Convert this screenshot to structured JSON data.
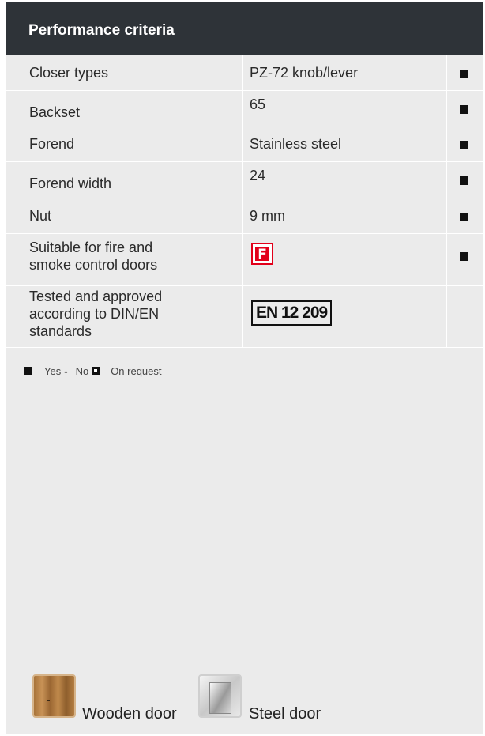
{
  "header": {
    "title": "Performance criteria"
  },
  "rows": [
    {
      "label": "Closer types",
      "value": "PZ-72 knob/lever",
      "mark": "yes"
    },
    {
      "label": "Backset",
      "value": "65",
      "mark": "yes"
    },
    {
      "label": "Forend",
      "value": "Stainless steel",
      "mark": "yes"
    },
    {
      "label": "Forend width",
      "value": "24",
      "mark": "yes"
    },
    {
      "label": "Nut",
      "value": "9 mm",
      "mark": "yes"
    },
    {
      "label_line1": "Suitable for fire and",
      "label_line2": "smoke control doors",
      "badge": "F",
      "mark": "yes"
    },
    {
      "label_line1": "Tested and approved",
      "label_line2": "according to DIN/EN",
      "label_line3": "standards",
      "badge": "EN 12 209"
    }
  ],
  "legend": {
    "yes": "Yes",
    "no": "No",
    "on_request": "On request"
  },
  "doors": {
    "wooden": "Wooden door",
    "steel": "Steel door"
  },
  "colors": {
    "header_bg": "#2e3338",
    "panel_bg": "#ebebeb",
    "fire_red": "#e2001a"
  }
}
